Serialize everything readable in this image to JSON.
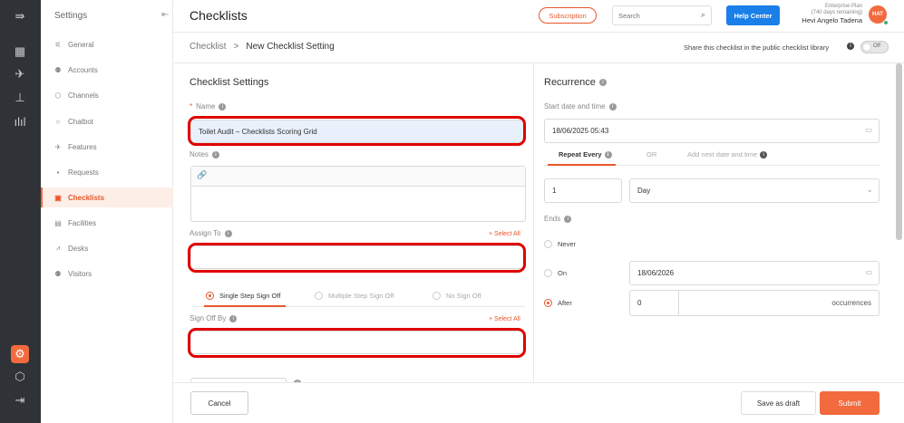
{
  "rail": {
    "icons": [
      "collapse-icon",
      "dashboard-icon",
      "pin-icon",
      "chart-icon",
      "analytics-icon",
      "gear-icon",
      "box-icon",
      "logout-icon"
    ]
  },
  "sidebar": {
    "title": "Settings",
    "items": [
      {
        "label": "General"
      },
      {
        "label": "Accounts"
      },
      {
        "label": "Channels"
      },
      {
        "label": "Chatbot"
      },
      {
        "label": "Features"
      },
      {
        "label": "Requests"
      },
      {
        "label": "Checklists"
      },
      {
        "label": "Facilities"
      },
      {
        "label": "Desks"
      },
      {
        "label": "Visitors"
      }
    ]
  },
  "topbar": {
    "title": "Checklists",
    "subscription": "Subscription",
    "search_placeholder": "Search",
    "help": "Help Center",
    "plan": "Enterprise Plan",
    "days_remaining": "(740 days remaining)",
    "user_name": "Hevi Angelo Tadena",
    "avatar_initials": "HAT"
  },
  "breadcrumb": {
    "root": "Checklist",
    "separator": ">",
    "current": "New Checklist Setting"
  },
  "share": {
    "label": "Share this checklist in the public checklist library",
    "toggle_label": "Off"
  },
  "checklist_settings": {
    "title": "Checklist Settings",
    "name_required": "*",
    "name_label": "Name",
    "name_value": "Toilet Audit – Checklists Scoring Grid",
    "notes_label": "Notes",
    "assign_to_label": "Assign To",
    "select_all": "+ Select All",
    "signoff_options": [
      "Single Step Sign Off",
      "Multiple Step Sign Off",
      "No Sign Off"
    ],
    "signoff_selected": "Single Step Sign Off",
    "sign_off_by_label": "Sign Off By"
  },
  "recurrence": {
    "title": "Recurrence",
    "start_label": "Start date and time",
    "start_value": "18/06/2025 05:43",
    "tabs": [
      "Repeat Every",
      "OR",
      "Add next date and time"
    ],
    "active_tab": "Repeat Every",
    "repeat_count": "1",
    "repeat_unit": "Day",
    "ends_label": "Ends",
    "end_never": "Never",
    "end_on": "On",
    "end_on_date": "18/06/2026",
    "end_after": "After",
    "end_after_count": "0",
    "occurrences": "occurrences",
    "ends_selected": "After"
  },
  "footer": {
    "cancel": "Cancel",
    "save_draft": "Save as draft",
    "submit": "Submit"
  },
  "colors": {
    "accent": "#f26a3d",
    "primary_blue": "#1a7fe8",
    "highlight_red": "#e00000"
  }
}
